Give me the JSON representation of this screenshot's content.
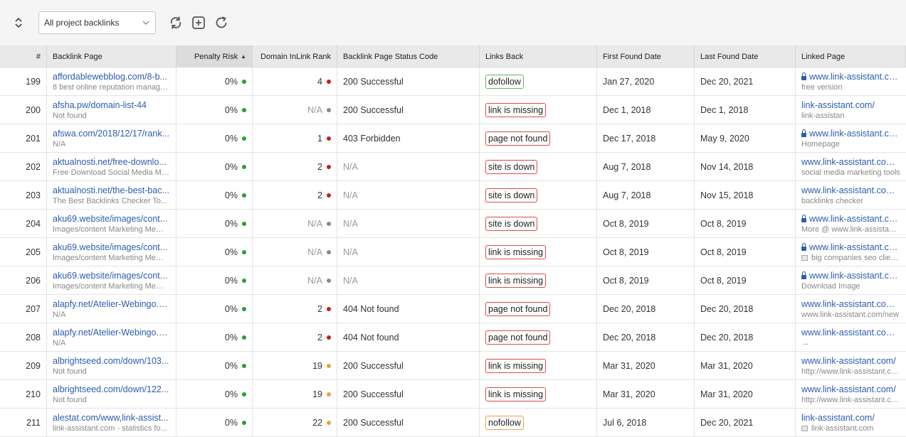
{
  "toolbar": {
    "filter_value": "All project backlinks"
  },
  "colors": {
    "green": "#2aa02a",
    "red": "#c0221f",
    "gray": "#8a8a8a",
    "orange": "#e8a33a",
    "badge_green": "#5cb85c",
    "badge_red": "#e04a4a",
    "badge_orange": "#eaa04a"
  },
  "columns": [
    {
      "key": "num",
      "label": "#"
    },
    {
      "key": "page",
      "label": "Backlink Page"
    },
    {
      "key": "risk",
      "label": "Penalty Risk",
      "sort_icon": "sort-up-icon"
    },
    {
      "key": "rank",
      "label": "Domain InLink Rank"
    },
    {
      "key": "status",
      "label": "Backlink Page Status Code"
    },
    {
      "key": "links",
      "label": "Links Back"
    },
    {
      "key": "first",
      "label": "First Found Date"
    },
    {
      "key": "last",
      "label": "Last Found Date"
    },
    {
      "key": "linked",
      "label": "Linked Page"
    }
  ],
  "rows": [
    {
      "num": "199",
      "page": "affordablewebblog.com/8-b...",
      "page_title": "8 best online reputation manage...",
      "risk": "0%",
      "risk_color": "green",
      "rank": "4",
      "rank_color": "red",
      "status": "200 Successful",
      "links": "dofollow",
      "links_color": "badge_green",
      "first": "Jan 27, 2020",
      "last": "Dec 20, 2021",
      "linked": "www.link-assistant.com/",
      "linked_secure": true,
      "anchor": "free version",
      "anchor_icon": ""
    },
    {
      "num": "200",
      "page": "afsha.pw/domain-list-44",
      "page_title": "Not found",
      "risk": "0%",
      "risk_color": "green",
      "rank": "N/A",
      "rank_color": "gray",
      "status": "200 Successful",
      "links": "link is missing",
      "links_color": "badge_red",
      "first": "Dec 1, 2018",
      "last": "Dec 1, 2018",
      "linked": "link-assistant.com/",
      "linked_secure": false,
      "anchor": "link-assistan",
      "anchor_icon": ""
    },
    {
      "num": "201",
      "page": "afswa.com/2018/12/17/rank...",
      "page_title": "N/A",
      "risk": "0%",
      "risk_color": "green",
      "rank": "1",
      "rank_color": "red",
      "status": "403 Forbidden",
      "links": "page not found",
      "links_color": "badge_red",
      "first": "Dec 17, 2018",
      "last": "May 9, 2020",
      "linked": "www.link-assistant.com/",
      "linked_secure": true,
      "anchor": "Homepage",
      "anchor_icon": ""
    },
    {
      "num": "202",
      "page": "aktualnosti.net/free-downlo...",
      "page_title": "Free Download Social Media Ma...",
      "risk": "0%",
      "risk_color": "green",
      "rank": "2",
      "rank_color": "red",
      "status": "N/A",
      "links": "site is down",
      "links_color": "badge_red",
      "first": "Aug 7, 2018",
      "last": "Nov 14, 2018",
      "linked": "www.link-assistant.com/bu",
      "linked_secure": false,
      "anchor": "social media marketing tools",
      "anchor_icon": ""
    },
    {
      "num": "203",
      "page": "aktualnosti.net/the-best-bac...",
      "page_title": "The Best Backlinks Checker To...",
      "risk": "0%",
      "risk_color": "green",
      "rank": "2",
      "rank_color": "red",
      "status": "N/A",
      "links": "site is down",
      "links_color": "badge_red",
      "first": "Aug 7, 2018",
      "last": "Nov 15, 2018",
      "linked": "www.link-assistant.com/se",
      "linked_secure": false,
      "anchor": "backlinks checker",
      "anchor_icon": ""
    },
    {
      "num": "204",
      "page": "aku69.website/images/cont...",
      "page_title": "Images/content Marketing Meme...",
      "risk": "0%",
      "risk_color": "green",
      "rank": "N/A",
      "rank_color": "gray",
      "status": "N/A",
      "links": "site is down",
      "links_color": "badge_red",
      "first": "Oct 8, 2019",
      "last": "Oct 8, 2019",
      "linked": "www.link-assistant.com/",
      "linked_secure": true,
      "anchor": "More @ www.link-assistant.c",
      "anchor_icon": ""
    },
    {
      "num": "205",
      "page": "aku69.website/images/cont...",
      "page_title": "Images/content Marketing Meme...",
      "risk": "0%",
      "risk_color": "green",
      "rank": "N/A",
      "rank_color": "gray",
      "status": "N/A",
      "links": "link is missing",
      "links_color": "badge_red",
      "first": "Oct 8, 2019",
      "last": "Oct 8, 2019",
      "linked": "www.link-assistant.com/",
      "linked_secure": true,
      "anchor": "big companies seo clients s",
      "anchor_icon": "image-icon"
    },
    {
      "num": "206",
      "page": "aku69.website/images/cont...",
      "page_title": "Images/content Marketing Meme...",
      "risk": "0%",
      "risk_color": "green",
      "rank": "N/A",
      "rank_color": "gray",
      "status": "N/A",
      "links": "link is missing",
      "links_color": "badge_red",
      "first": "Oct 8, 2019",
      "last": "Oct 8, 2019",
      "linked": "www.link-assistant.com/",
      "linked_secure": true,
      "anchor": "Download Image",
      "anchor_icon": ""
    },
    {
      "num": "207",
      "page": "alapfy.net/Atelier-Webingo.h...",
      "page_title": "N/A",
      "risk": "0%",
      "risk_color": "green",
      "rank": "2",
      "rank_color": "red",
      "status": "404 Not found",
      "links": "page not found",
      "links_color": "badge_red",
      "first": "Dec 20, 2018",
      "last": "Dec 20, 2018",
      "linked": "www.link-assistant.com/ne",
      "linked_secure": false,
      "anchor": "www.link-assistant.com/new",
      "anchor_icon": ""
    },
    {
      "num": "208",
      "page": "alapfy.net/Atelier-Webingo.h...",
      "page_title": "N/A",
      "risk": "0%",
      "risk_color": "green",
      "rank": "2",
      "rank_color": "red",
      "status": "404 Not found",
      "links": "page not found",
      "links_color": "badge_red",
      "first": "Dec 20, 2018",
      "last": "Dec 20, 2018",
      "linked": "www.link-assistant.com/ne",
      "linked_secure": false,
      "anchor": "→",
      "anchor_icon": ""
    },
    {
      "num": "209",
      "page": "albrightseed.com/down/103...",
      "page_title": "Not found",
      "risk": "0%",
      "risk_color": "green",
      "rank": "19",
      "rank_color": "orange",
      "status": "200 Successful",
      "links": "link is missing",
      "links_color": "badge_red",
      "first": "Mar 31, 2020",
      "last": "Mar 31, 2020",
      "linked": "www.link-assistant.com/",
      "linked_secure": false,
      "anchor": "http://www.link-assistant.com",
      "anchor_icon": ""
    },
    {
      "num": "210",
      "page": "albrightseed.com/down/122...",
      "page_title": "Not found",
      "risk": "0%",
      "risk_color": "green",
      "rank": "19",
      "rank_color": "orange",
      "status": "200 Successful",
      "links": "link is missing",
      "links_color": "badge_red",
      "first": "Mar 31, 2020",
      "last": "Mar 31, 2020",
      "linked": "www.link-assistant.com/",
      "linked_secure": false,
      "anchor": "http://www.link-assistant.com",
      "anchor_icon": ""
    },
    {
      "num": "211",
      "page": "alestat.com/www,link-assist...",
      "page_title": "link-assistant.com - statistics fo...",
      "risk": "0%",
      "risk_color": "green",
      "rank": "22",
      "rank_color": "orange",
      "status": "200 Successful",
      "links": "nofollow",
      "links_color": "badge_orange",
      "first": "Jul 6, 2018",
      "last": "Dec 20, 2021",
      "linked": "link-assistant.com/",
      "linked_secure": false,
      "anchor": "link-assistant.com",
      "anchor_icon": "image-icon"
    }
  ]
}
